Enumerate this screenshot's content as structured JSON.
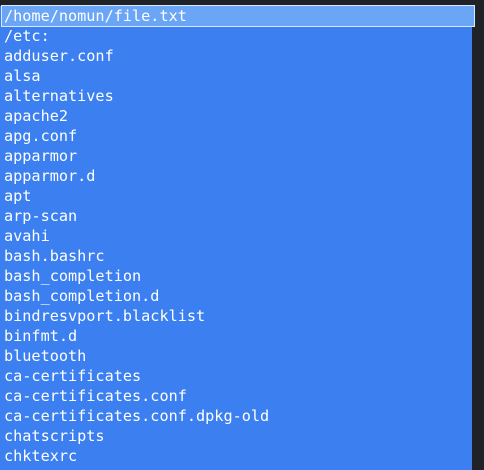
{
  "terminal": {
    "path": "/home/nomun/file.txt",
    "lines": [
      "/etc:",
      "adduser.conf",
      "alsa",
      "alternatives",
      "apache2",
      "apg.conf",
      "apparmor",
      "apparmor.d",
      "apt",
      "arp-scan",
      "avahi",
      "bash.bashrc",
      "bash_completion",
      "bash_completion.d",
      "bindresvport.blacklist",
      "binfmt.d",
      "bluetooth",
      "ca-certificates",
      "ca-certificates.conf",
      "ca-certificates.conf.dpkg-old",
      "chatscripts",
      "chktexrc"
    ]
  },
  "colors": {
    "background": "#1f2328",
    "selection": "#3b7ff0",
    "path_highlight": "#6aa6f5",
    "text": "#ffffff"
  }
}
